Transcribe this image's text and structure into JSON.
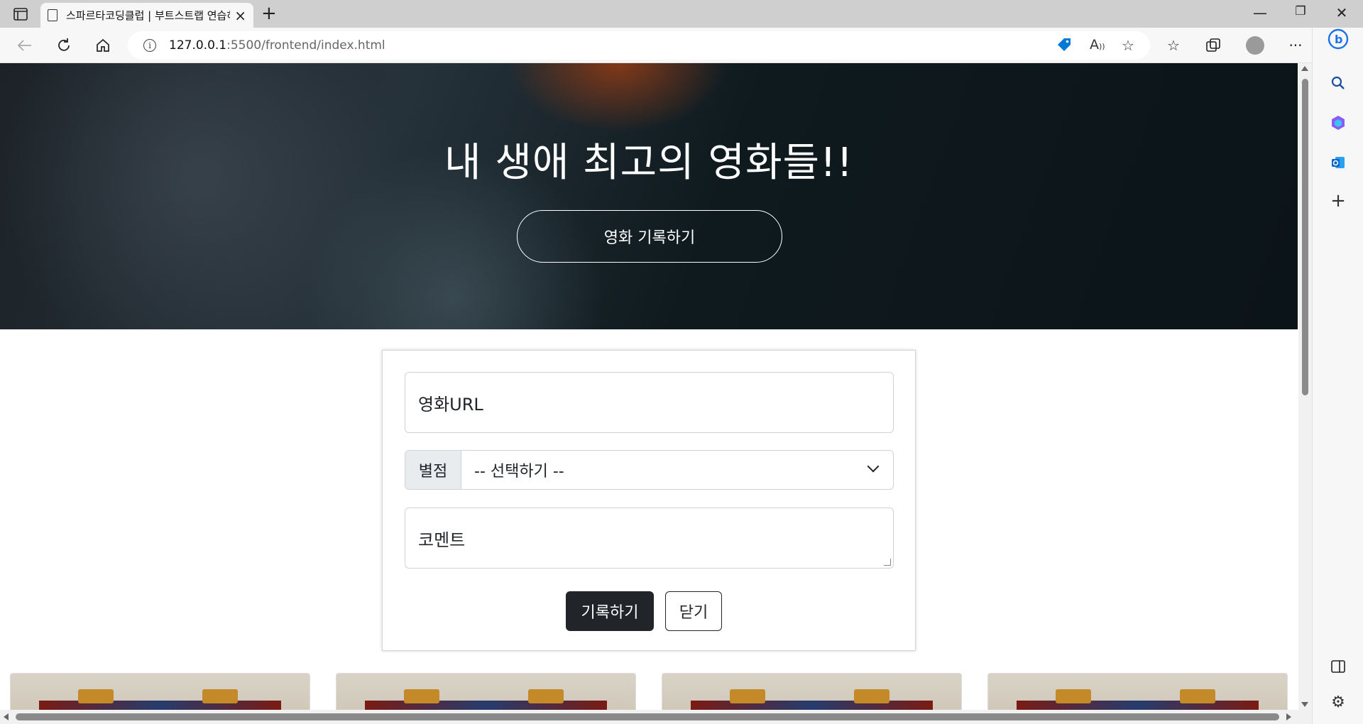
{
  "browser": {
    "tab_title": "스파르타코딩클럽 | 부트스트랩 연습하기",
    "url_host": "127.0.0.1",
    "url_path": ":5500/frontend/index.html",
    "new_tab_symbol": "+",
    "close_tab_symbol": "×",
    "window_controls": {
      "minimize": "—",
      "restore": "❐",
      "close": "✕"
    }
  },
  "hero": {
    "title": "내 생애 최고의 영화들!!",
    "record_button": "영화 기록하기"
  },
  "form": {
    "url_placeholder": "영화URL",
    "rating_label": "별점",
    "rating_selected": "-- 선택하기 --",
    "comment_placeholder": "코멘트",
    "save_button": "기록하기",
    "close_button": "닫기"
  },
  "colors": {
    "brand_accent": "#0078d4",
    "dark_button": "#212529"
  }
}
